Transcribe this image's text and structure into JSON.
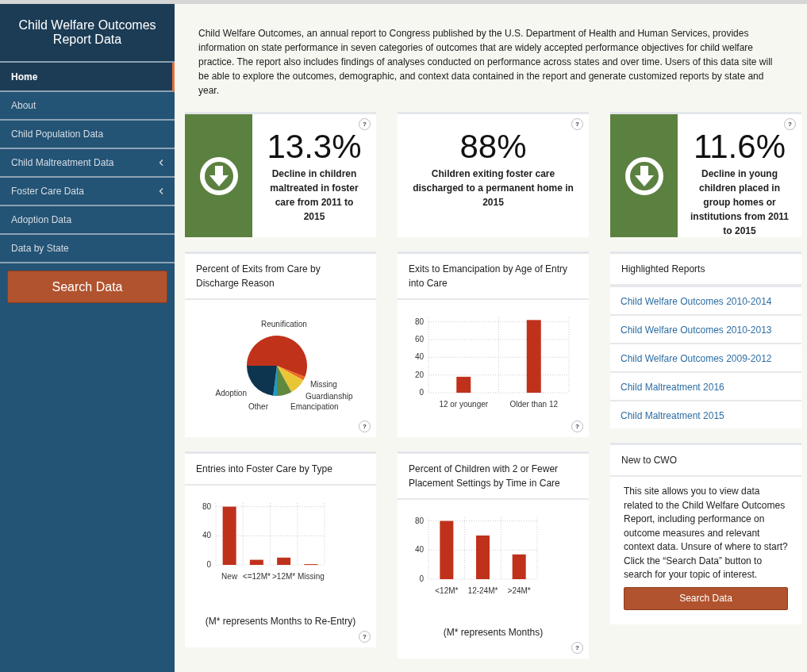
{
  "sidebar": {
    "title": "Child Welfare Outcomes Report Data",
    "items": [
      {
        "label": "Home",
        "selected": true,
        "has_submenu": false
      },
      {
        "label": "About",
        "selected": false,
        "has_submenu": false
      },
      {
        "label": "Child Population Data",
        "selected": false,
        "has_submenu": false
      },
      {
        "label": "Child Maltreatment Data",
        "selected": false,
        "has_submenu": true
      },
      {
        "label": "Foster Care Data",
        "selected": false,
        "has_submenu": true
      },
      {
        "label": "Adoption Data",
        "selected": false,
        "has_submenu": false
      },
      {
        "label": "Data by State",
        "selected": false,
        "has_submenu": false
      }
    ],
    "button": "Search Data"
  },
  "intro": "Child Welfare Outcomes, an annual report to Congress published by the U.S. Department of Health and Human Services, provides information on state performance in seven categories of outcomes that are widely accepted performance objectives for child welfare practice. The report also includes findings of analyses conducted on performance across states and over time. Users of this data site will be able to explore the outcomes, demographic, and context data contained in the report and generate customized reports by state and year.",
  "stats": [
    {
      "kind": "decline",
      "value": "13.3%",
      "caption": "Decline in children maltreated in foster care from 2011 to 2015",
      "help": "?"
    },
    {
      "kind": "plain",
      "value": "88%",
      "caption": "Children exiting foster care discharged to a permanent home in 2015",
      "help": "?"
    },
    {
      "kind": "decline",
      "value": "11.6%",
      "caption": "Decline in young children placed in group homes or institutions from 2011 to 2015",
      "help": "?"
    }
  ],
  "chart_cards": [
    {
      "title": "Percent of Exits from Care by Discharge Reason",
      "help": "?",
      "chart_data": {
        "type": "pie",
        "categories": [
          "Reunification",
          "Missing",
          "Guardianship",
          "Emancipation",
          "Other",
          "Adoption"
        ],
        "values": [
          56,
          2,
          9,
          8,
          2,
          23
        ],
        "colors": [
          "#c0321a",
          "#f0661e",
          "#e8c636",
          "#5f8a3e",
          "#1e9bc8",
          "#0e3550"
        ]
      }
    },
    {
      "title": "Exits to Emancipation by Age of Entry into Care",
      "help": "?",
      "chart_data": {
        "type": "bar",
        "categories": [
          "12 or younger",
          "Older than 12"
        ],
        "values": [
          18,
          82
        ],
        "ylim": [
          0,
          85
        ],
        "grid": true,
        "yticks": [
          0,
          20,
          40,
          60,
          80
        ]
      }
    },
    {
      "title": "Entries into Foster Care by Type",
      "help": "?",
      "note": "(M* represents Months to Re-Entry)",
      "chart_data": {
        "type": "bar",
        "categories": [
          "New",
          "<=12M*",
          ">12M*",
          "Missing"
        ],
        "values": [
          80,
          7,
          10,
          1
        ],
        "ylim": [
          0,
          85
        ],
        "grid": true,
        "yticks": [
          0,
          40,
          80
        ]
      }
    },
    {
      "title": "Percent of Children with 2 or Fewer Placement Settings by Time in Care",
      "help": "?",
      "note": "(M* represents Months)",
      "chart_data": {
        "type": "bar",
        "categories": [
          "<12M*",
          "12-24M*",
          ">24M*"
        ],
        "values": [
          80,
          60,
          34
        ],
        "ylim": [
          0,
          85
        ],
        "grid": true,
        "yticks": [
          0,
          40,
          80
        ]
      }
    }
  ],
  "reports": {
    "title": "Highlighted Reports",
    "links": [
      "Child Welfare Outcomes 2010-2014",
      "Child Welfare Outcomes 2010-2013",
      "Child Welfare Outcomes 2009-2012",
      "Child Maltreatment 2016",
      "Child Maltreatment 2015"
    ]
  },
  "new_to_cwo": {
    "title": "New to CWO",
    "text": "This site allows you to view data related to the Child Welfare Outcomes Report, including performance on outcome measures and relevant context data. Unsure of where to start? Click the “Search Data” button to search for your topic of interest.",
    "button": "Search Data"
  }
}
